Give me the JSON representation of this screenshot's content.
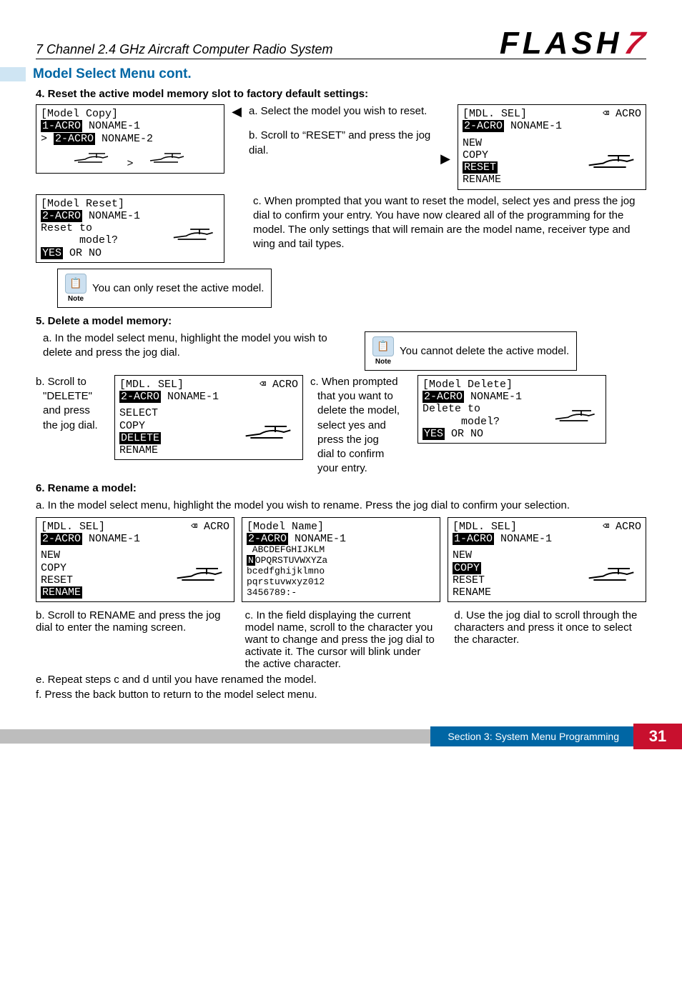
{
  "header": {
    "title": "7 Channel 2.4 GHz Aircraft Computer Radio System",
    "logo_text": "FLASH",
    "logo_seven": "7"
  },
  "section_title": "Model Select Menu cont.",
  "step4": {
    "title": "4. Reset the active model memory slot to factory default settings:",
    "lcd_copy": {
      "title": "[Model Copy]",
      "l1_tag": "1-ACRO",
      "l1_name": " NONAME-1",
      "l2_tag": "2-ACRO",
      "l2_name": " NONAME-2",
      "arrow": ">"
    },
    "a": "a. Select the model you wish to reset.",
    "b": "b. Scroll to “RESET” and press the jog dial.",
    "lcd_sel": {
      "title": "[MDL. SEL]",
      "corner": "⌫ ACRO",
      "tag": "2-ACRO",
      "name": " NONAME-1",
      "opt1": "NEW",
      "opt2": "COPY",
      "opt3": "RESET",
      "opt4": "RENAME"
    },
    "lcd_reset": {
      "title": "[Model Reset]",
      "tag": "2-ACRO",
      "name": " NONAME-1",
      "l1": "Reset to",
      "l2": "      model?",
      "yn": "YES",
      "yn2": " OR NO"
    },
    "c": "c. When prompted that you want to reset the model, select yes and press the jog dial to confirm your entry. You have now cleared  all of the programming for the model. The only settings  that will remain are the model  name, receiver type and wing and tail types."
  },
  "note1": "You can only reset the active model.",
  "step5": {
    "title": "5. Delete a model memory:",
    "a": "a. In the model select menu, highlight the model you wish to delete and press the jog dial.",
    "note": "You cannot delete the active model.",
    "b_label": "b. Scroll to \"DELETE\" and press the jog dial.",
    "b_prefix": "b. Scroll to",
    "b_word": "\"DELETE\"",
    "b_rest1": "and press",
    "b_rest2": "the jog dial.",
    "lcd_del_sel": {
      "title": "[MDL. SEL]",
      "corner": "⌫ ACRO",
      "tag": "2-ACRO",
      "name": " NONAME-1",
      "opt1": "SELECT",
      "opt2": "COPY",
      "opt3": "DELETE",
      "opt4": "RENAME"
    },
    "c_prefix": "c. When prompted",
    "c_l2": "that you want to",
    "c_l3": "delete the model,",
    "c_l4": "select yes and",
    "c_l5": "press the jog",
    "c_l6": "dial to confirm",
    "c_l7": "your entry.",
    "lcd_del": {
      "title": "[Model Delete]",
      "tag": "2-ACRO",
      "name": " NONAME-1",
      "l1": "Delete to",
      "l2": "      model?",
      "yn": "YES",
      "yn2": " OR NO"
    }
  },
  "step6": {
    "title": "6. Rename a model:",
    "a": "a. In the model select menu, highlight the model you wish to rename. Press the jog dial to confirm your selection.",
    "lcd1": {
      "title": "[MDL. SEL]",
      "corner": "⌫ ACRO",
      "tag": "2-ACRO",
      "name": " NONAME-1",
      "opt1": "NEW",
      "opt2": "COPY",
      "opt3": "RESET",
      "opt4": "RENAME"
    },
    "lcd2": {
      "title": "[Model Name]",
      "tag": "2-ACRO",
      "name": " NONAME-1",
      "row1": " ABCDEFGHIJKLM",
      "row2_n": "N",
      "row2": "OPQRSTUVWXYZa",
      "row3": "bcedfghijklmno",
      "row4": "pqrstuvwxyz012",
      "row5": "3456789:-"
    },
    "lcd3": {
      "title": "[MDL. SEL]",
      "corner": "⌫ ACRO",
      "tag": "1-ACRO",
      "name": " NONAME-1",
      "opt1": "NEW",
      "opt2": "COPY",
      "opt3": "RESET",
      "opt4": "RENAME"
    },
    "b": "b. Scroll to RENAME and press the jog dial to enter the naming screen.",
    "c": "c. In the field displaying the current model name, scroll to the character you want to change and press the jog dial to activate it. The cursor will blink under the active character.",
    "d": "d. Use the jog dial to scroll through the characters and press it once to select the character.",
    "e": "e. Repeat steps c and d until you have renamed the model.",
    "f": "f. Press the back button to return to the model select menu."
  },
  "footer": {
    "section": "Section 3: System Menu Programming",
    "page": "31"
  }
}
